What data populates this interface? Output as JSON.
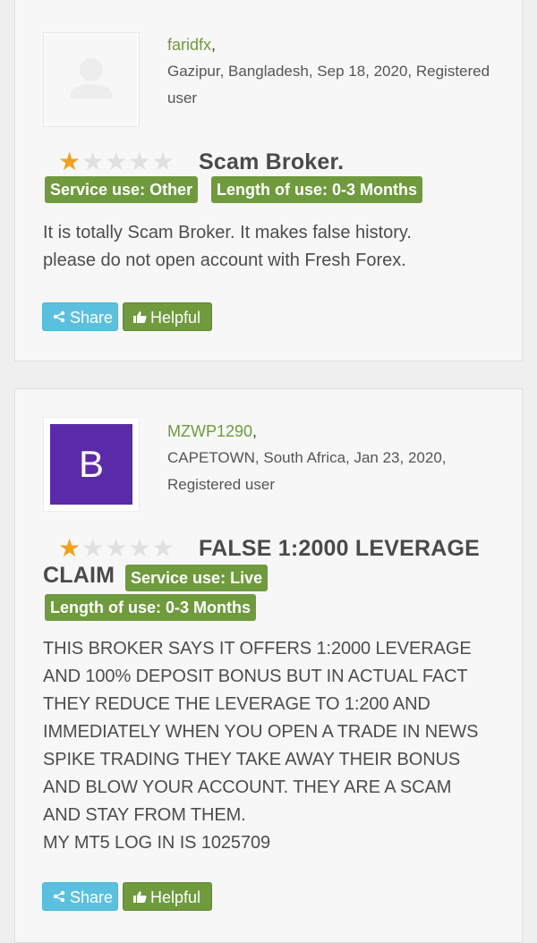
{
  "reviews": [
    {
      "username": "faridfx",
      "location_line": "Gazipur, Bangladesh, Sep 18, 2020, Registered user",
      "avatar": {
        "type": "placeholder",
        "icon": "user-silhouette-icon"
      },
      "rating": 1,
      "rating_max": 5,
      "title": "Scam Broker.",
      "service_use": "Service use: Other",
      "length_of_use": "Length of use: 0-3 Months",
      "body": "It is totally Scam Broker. It makes false history.\nplease do not open account with Fresh Forex.",
      "share_label": "Share",
      "helpful_label": "Helpful"
    },
    {
      "username": "MZWP1290",
      "location_line": "CAPETOWN, South Africa, Jan 23, 2020, Registered user",
      "avatar": {
        "type": "letter",
        "letter": "B",
        "color": "#5b2aa8"
      },
      "rating": 1,
      "rating_max": 5,
      "title": "FALSE 1:2000 LEVERAGE CLAIM",
      "title_line1": "FALSE 1:2000 LEVERAGE",
      "title_line2": "CLAIM",
      "service_use": "Service use: Live",
      "length_of_use": "Length of use: 0-3 Months",
      "body": "THIS BROKER SAYS IT OFFERS 1:2000 LEVERAGE\nAND 100% DEPOSIT BONUS BUT IN ACTUAL FACT\nTHEY REDUCE THE LEVERAGE TO 1:200 AND\nIMMEDIATELY WHEN YOU OPEN A TRADE IN NEWS\nSPIKE TRADING THEY TAKE AWAY THEIR BONUS\nAND BLOW YOUR ACCOUNT. THEY ARE A SCAM\nAND STAY FROM THEM.\nMY MT5 LOG IN IS 1025709",
      "share_label": "Share",
      "helpful_label": "Helpful"
    }
  ],
  "colors": {
    "accent_green": "#6f9a3d",
    "share_blue": "#5bc0de",
    "star_on": "#f0a21b",
    "star_off": "#e0e0e0"
  }
}
